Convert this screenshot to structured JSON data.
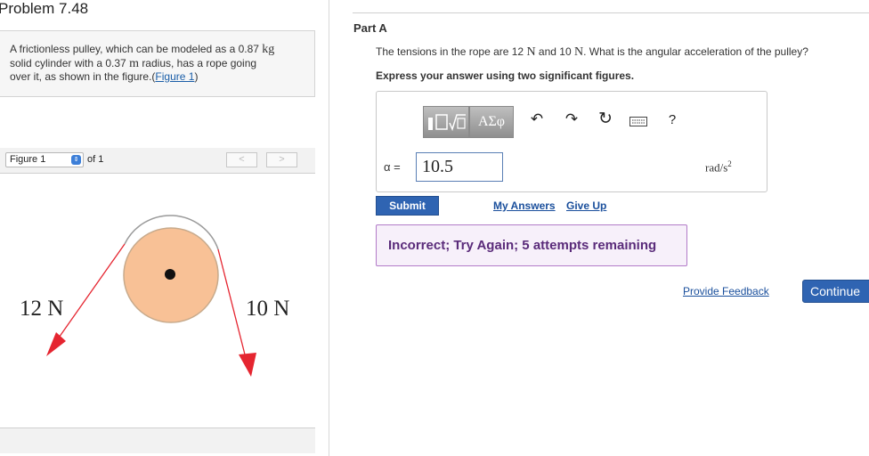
{
  "problem": {
    "title": "Problem 7.48",
    "text_1": "A frictionless pulley, which can be modeled as a 0.87",
    "unit_kg": "kg",
    "text_2": "solid cylinder with a 0.37",
    "unit_m": "m",
    "text_3": "radius, has a rope going",
    "text_4": "over it, as shown in the figure.(",
    "figure_link": "Figure 1",
    "text_5": ")"
  },
  "figure": {
    "selector": "Figure 1",
    "of_label": "of 1",
    "prev": "<",
    "next": ">",
    "left_tension": "12 N",
    "right_tension": "10 N",
    "colors": {
      "pulley_fill": "#f8c196",
      "pulley_stroke": "#c7aa8c",
      "rope": "#e52530",
      "arrow": "#e52530"
    }
  },
  "part": {
    "label": "Part A",
    "q_1": "The tensions in the rope are 12",
    "q_n1": "N",
    "q_2": "and 10",
    "q_n2": "N",
    "q_3": ". What is the angular acceleration of the pulley?",
    "instruction": "Express your answer using two significant figures.",
    "toolbar": {
      "template_icon": "template-icon",
      "greek": "ΑΣφ",
      "undo": "↶",
      "redo": "↷",
      "reset": "↻",
      "keyboard": "keyboard-icon",
      "help": "?"
    },
    "alpha_label": "α =",
    "answer_value": "10.5",
    "unit": "rad/s",
    "unit_exp": "2",
    "submit": "Submit",
    "my_answers": "My Answers",
    "give_up": "Give Up",
    "feedback": "Incorrect; Try Again; 5 attempts remaining"
  },
  "footer": {
    "provide_feedback": "Provide Feedback",
    "continue": "Continue"
  }
}
